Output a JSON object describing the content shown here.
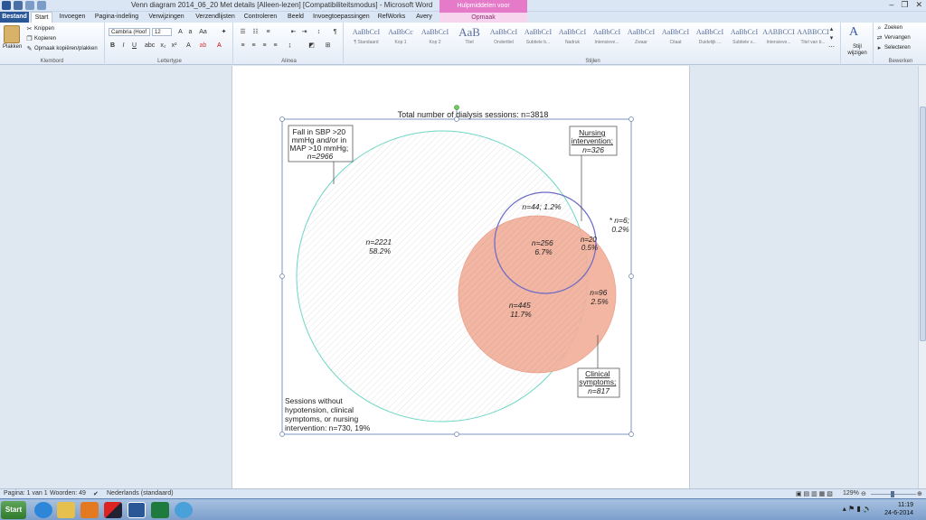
{
  "window": {
    "title": "Venn diagram 2014_06_20 Met details [Alleen-lezen] [Compatibiliteitsmodus] - Microsoft Word",
    "contextual_group": "Hulpmiddelen voor afbeeldingen",
    "controls": {
      "minimize": "–",
      "restore": "❐",
      "close": "✕"
    }
  },
  "tabs": [
    "Bestand",
    "Start",
    "Invoegen",
    "Pagina-indeling",
    "Verwijzingen",
    "Verzendlijsten",
    "Controleren",
    "Beeld",
    "Invoegtoepassingen",
    "RefWorks",
    "Avery",
    "Opmaak"
  ],
  "ribbon": {
    "clipboard": {
      "paste": "Plakken",
      "cut": "Knippen",
      "copy": "Kopieren",
      "format_painter": "Opmaak kopiëren/plakken",
      "group": "Klembord"
    },
    "font": {
      "name": "Cambria (Hoof",
      "size": "12",
      "group": "Lettertype"
    },
    "paragraph": {
      "group": "Alinea"
    },
    "styles": {
      "group": "Stijlen",
      "items": [
        {
          "sample": "AaBbCcI",
          "name": "¶ Standaard"
        },
        {
          "sample": "AaBbCc",
          "name": "Kop 1"
        },
        {
          "sample": "AaBbCcI",
          "name": "Kop 2"
        },
        {
          "sample": "AaB",
          "name": "Titel"
        },
        {
          "sample": "AaBbCcI",
          "name": "Ondertitel"
        },
        {
          "sample": "AaBbCcI",
          "name": "Subtiele b..."
        },
        {
          "sample": "AaBbCcI",
          "name": "Nadruk"
        },
        {
          "sample": "AaBbCcI",
          "name": "Intensieve..."
        },
        {
          "sample": "AaBbCcI",
          "name": "Zwaar"
        },
        {
          "sample": "AaBbCcI",
          "name": "Citaat"
        },
        {
          "sample": "AaBbCcI",
          "name": "Duidelijk ..."
        },
        {
          "sample": "AaBbCcI",
          "name": "Subtiele v..."
        },
        {
          "sample": "AABBCCI",
          "name": "Intensieve..."
        },
        {
          "sample": "AABBCCI",
          "name": "Titel van b..."
        }
      ],
      "change_styles": "Stijl wijzigen"
    },
    "editing": {
      "group": "Bewerken",
      "find": "Zoeken",
      "replace": "Vervangen",
      "select": "Selecteren"
    }
  },
  "venn": {
    "title": "Total number of dialysis sessions: n=3818",
    "label_sbp": [
      "Fall in SBP >20",
      "mmHg and/or in",
      "MAP >10 mmHg;",
      "n=2966"
    ],
    "label_nursing": [
      "Nursing",
      "intervention;",
      "n=326"
    ],
    "label_clinical": [
      "Clinical",
      "symptoms;",
      "n=817"
    ],
    "region_sbp_only": [
      "n=2221",
      "58.2%"
    ],
    "region_sbp_nursing": "n=44; 1.2%",
    "region_all_three": [
      "n=256",
      "6.7%"
    ],
    "region_nursing_clinical": [
      "n=20",
      "0.5%"
    ],
    "region_nursing_only": [
      "* n=6;",
      "0.2%"
    ],
    "region_sbp_clinical": [
      "n=445",
      "11.7%"
    ],
    "region_clinical_only": [
      "n=96",
      "2.5%"
    ],
    "none": [
      "Sessions without",
      "hypotension, clinical",
      "symptoms, or nursing",
      "intervention: n=730, 19%"
    ],
    "colors": {
      "sbp": "#6fd7c6",
      "clinical": "#f2b09c",
      "nursing": "#6a68c8"
    }
  },
  "status": {
    "page": "Pagina: 1 van 1",
    "words": "Woorden: 49",
    "language": "Nederlands (standaard)",
    "zoom": "129%"
  },
  "taskbar": {
    "start": "Start",
    "time": "11:19",
    "date": "24-6-2014"
  }
}
